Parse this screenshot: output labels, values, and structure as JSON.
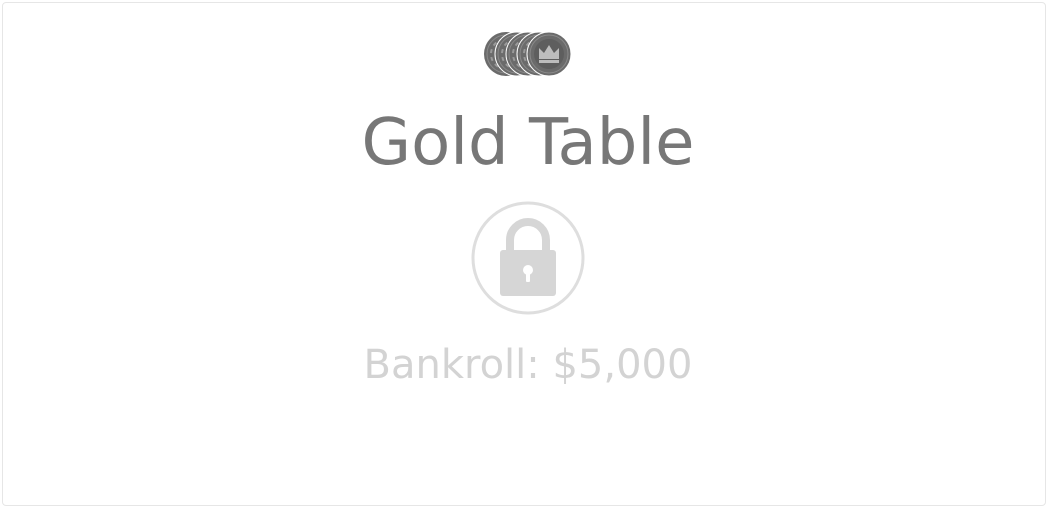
{
  "table": {
    "name": "Gold Table",
    "locked": true,
    "chip_icon": "crown-chip-stack-icon",
    "lock_icon": "padlock-icon",
    "bankroll_label": "Bankroll: $5,000"
  },
  "colors": {
    "title": "#777777",
    "chip": "#6b6b6b",
    "chip_light": "#bdbdbd",
    "lock": "#d6d6d6",
    "lock_ring": "#dedede",
    "bankroll": "#d3d3d3"
  }
}
